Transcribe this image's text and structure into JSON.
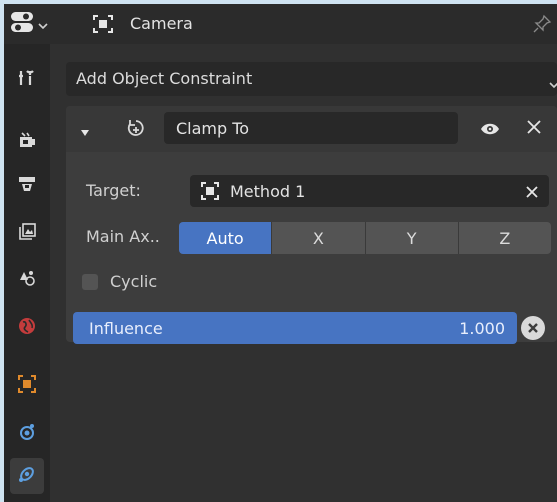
{
  "header": {
    "title": "Camera",
    "editor_type_icon": "properties-editor-icon",
    "pin_icon": "pin-icon"
  },
  "tabs": [
    {
      "name": "tool-tab",
      "icon": "tool-icon",
      "active": false
    },
    {
      "name": "render-tab",
      "icon": "render-icon",
      "active": false
    },
    {
      "name": "output-tab",
      "icon": "output-icon",
      "active": false
    },
    {
      "name": "view-layer-tab",
      "icon": "view-layer-icon",
      "active": false
    },
    {
      "name": "scene-tab",
      "icon": "scene-icon",
      "active": false
    },
    {
      "name": "world-tab",
      "icon": "world-icon",
      "active": false
    },
    {
      "name": "object-tab",
      "icon": "object-icon",
      "active": false
    },
    {
      "name": "physics-tab",
      "icon": "physics-icon",
      "active": false
    },
    {
      "name": "constraints-tab",
      "icon": "constraint-icon",
      "active": true
    }
  ],
  "main": {
    "add_constraint_label": "Add Object Constraint",
    "constraint": {
      "name": "Clamp To",
      "target_label": "Target:",
      "target_value": "Method 1",
      "main_axis_label": "Main Ax..",
      "axis_options": [
        "Auto",
        "X",
        "Y",
        "Z"
      ],
      "axis_selected": "Auto",
      "cyclic_label": "Cyclic",
      "cyclic_checked": false,
      "influence_label": "Influence",
      "influence_value": "1.000"
    }
  },
  "colors": {
    "accent": "#4774c2",
    "background": "#303030",
    "frame": "#cfe3f1"
  }
}
